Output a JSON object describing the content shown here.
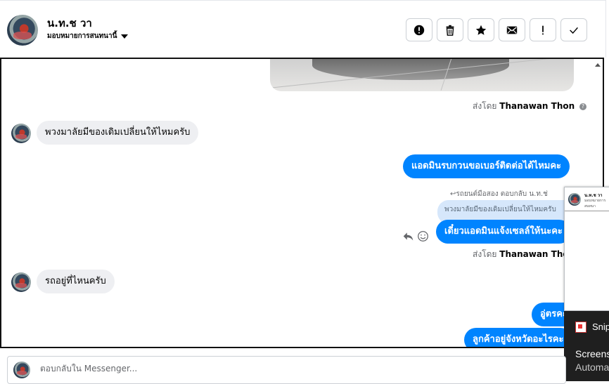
{
  "header": {
    "contact_name": "น.ท.ช วา",
    "assign_label": "มอบหมายการสนทนานี้",
    "toolbar": [
      {
        "name": "spam-button",
        "icon": "alert-circle-icon"
      },
      {
        "name": "delete-button",
        "icon": "trash-icon"
      },
      {
        "name": "star-button",
        "icon": "star-icon"
      },
      {
        "name": "mark-unread-button",
        "icon": "envelope-icon"
      },
      {
        "name": "follow-up-button",
        "icon": "exclamation-icon"
      },
      {
        "name": "mark-done-button",
        "icon": "check-icon"
      }
    ]
  },
  "messages": {
    "sent_by_prefix": "ส่งโดย",
    "sent_by_name": "Thanawan Thon",
    "m1": "พวงมาลัยมีของเดิมเปลี่ยนให้ไหมครับ",
    "m2": "แอดมินรบกวนขอเบอร์ติดต่อได้ไหมคะ",
    "reply_meta": "รถยนต์มือสอง ตอบกลับ น.ท.ช่",
    "quoted": "พวงมาลัยมีของเดิมเปลี่ยนให้ไหมครับ",
    "m3": "เดี๋ยวแอดมินแจ้งเซลล์ให้นะคะ",
    "m4": "รถอยู่ที่ไหนครับ",
    "m5": "อู่ตรคะ",
    "m6": "ลูกค้าอยู่จังหวัดอะไรคะ"
  },
  "overlay": {
    "mini_title": "น.ท.ช วา",
    "mini_sub": "มอบหมายการสนทนา"
  },
  "toast": {
    "app": "Snip",
    "title": "Screens",
    "subtitle": "Automa"
  },
  "composer": {
    "placeholder": "ตอบกลับใน Messenger..."
  },
  "colors": {
    "outgoing_bubble": "#0084ff",
    "incoming_bubble": "#eeeff2",
    "quoted_bubble": "#d6e7fb"
  }
}
